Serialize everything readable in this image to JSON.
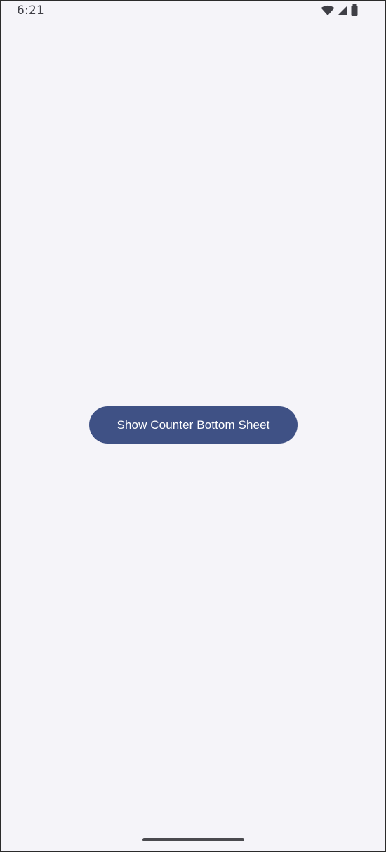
{
  "status_bar": {
    "time": "6:21",
    "icons": [
      "wifi-icon",
      "cellular-signal-icon",
      "battery-icon"
    ],
    "icon_color": "#3f3f46"
  },
  "main": {
    "button_label": "Show Counter Bottom Sheet",
    "button_color": "#3f5185",
    "background_color": "#f5f4f9"
  },
  "navigation": {
    "gesture_handle": "gesture-navigation-bar"
  }
}
